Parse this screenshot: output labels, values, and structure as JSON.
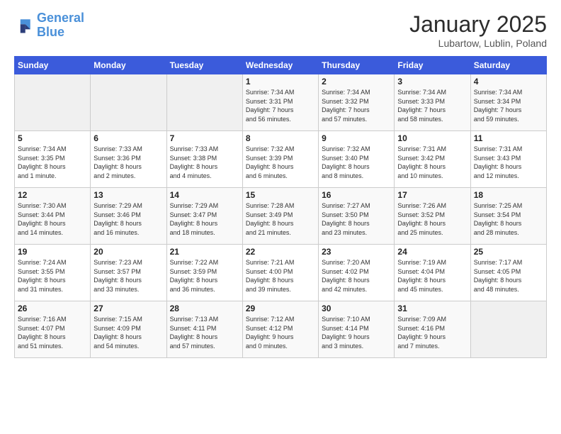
{
  "header": {
    "logo_line1": "General",
    "logo_line2": "Blue",
    "title": "January 2025",
    "subtitle": "Lubartow, Lublin, Poland"
  },
  "days_of_week": [
    "Sunday",
    "Monday",
    "Tuesday",
    "Wednesday",
    "Thursday",
    "Friday",
    "Saturday"
  ],
  "weeks": [
    [
      {
        "day": "",
        "info": ""
      },
      {
        "day": "",
        "info": ""
      },
      {
        "day": "",
        "info": ""
      },
      {
        "day": "1",
        "info": "Sunrise: 7:34 AM\nSunset: 3:31 PM\nDaylight: 7 hours\nand 56 minutes."
      },
      {
        "day": "2",
        "info": "Sunrise: 7:34 AM\nSunset: 3:32 PM\nDaylight: 7 hours\nand 57 minutes."
      },
      {
        "day": "3",
        "info": "Sunrise: 7:34 AM\nSunset: 3:33 PM\nDaylight: 7 hours\nand 58 minutes."
      },
      {
        "day": "4",
        "info": "Sunrise: 7:34 AM\nSunset: 3:34 PM\nDaylight: 7 hours\nand 59 minutes."
      }
    ],
    [
      {
        "day": "5",
        "info": "Sunrise: 7:34 AM\nSunset: 3:35 PM\nDaylight: 8 hours\nand 1 minute."
      },
      {
        "day": "6",
        "info": "Sunrise: 7:33 AM\nSunset: 3:36 PM\nDaylight: 8 hours\nand 2 minutes."
      },
      {
        "day": "7",
        "info": "Sunrise: 7:33 AM\nSunset: 3:38 PM\nDaylight: 8 hours\nand 4 minutes."
      },
      {
        "day": "8",
        "info": "Sunrise: 7:32 AM\nSunset: 3:39 PM\nDaylight: 8 hours\nand 6 minutes."
      },
      {
        "day": "9",
        "info": "Sunrise: 7:32 AM\nSunset: 3:40 PM\nDaylight: 8 hours\nand 8 minutes."
      },
      {
        "day": "10",
        "info": "Sunrise: 7:31 AM\nSunset: 3:42 PM\nDaylight: 8 hours\nand 10 minutes."
      },
      {
        "day": "11",
        "info": "Sunrise: 7:31 AM\nSunset: 3:43 PM\nDaylight: 8 hours\nand 12 minutes."
      }
    ],
    [
      {
        "day": "12",
        "info": "Sunrise: 7:30 AM\nSunset: 3:44 PM\nDaylight: 8 hours\nand 14 minutes."
      },
      {
        "day": "13",
        "info": "Sunrise: 7:29 AM\nSunset: 3:46 PM\nDaylight: 8 hours\nand 16 minutes."
      },
      {
        "day": "14",
        "info": "Sunrise: 7:29 AM\nSunset: 3:47 PM\nDaylight: 8 hours\nand 18 minutes."
      },
      {
        "day": "15",
        "info": "Sunrise: 7:28 AM\nSunset: 3:49 PM\nDaylight: 8 hours\nand 21 minutes."
      },
      {
        "day": "16",
        "info": "Sunrise: 7:27 AM\nSunset: 3:50 PM\nDaylight: 8 hours\nand 23 minutes."
      },
      {
        "day": "17",
        "info": "Sunrise: 7:26 AM\nSunset: 3:52 PM\nDaylight: 8 hours\nand 25 minutes."
      },
      {
        "day": "18",
        "info": "Sunrise: 7:25 AM\nSunset: 3:54 PM\nDaylight: 8 hours\nand 28 minutes."
      }
    ],
    [
      {
        "day": "19",
        "info": "Sunrise: 7:24 AM\nSunset: 3:55 PM\nDaylight: 8 hours\nand 31 minutes."
      },
      {
        "day": "20",
        "info": "Sunrise: 7:23 AM\nSunset: 3:57 PM\nDaylight: 8 hours\nand 33 minutes."
      },
      {
        "day": "21",
        "info": "Sunrise: 7:22 AM\nSunset: 3:59 PM\nDaylight: 8 hours\nand 36 minutes."
      },
      {
        "day": "22",
        "info": "Sunrise: 7:21 AM\nSunset: 4:00 PM\nDaylight: 8 hours\nand 39 minutes."
      },
      {
        "day": "23",
        "info": "Sunrise: 7:20 AM\nSunset: 4:02 PM\nDaylight: 8 hours\nand 42 minutes."
      },
      {
        "day": "24",
        "info": "Sunrise: 7:19 AM\nSunset: 4:04 PM\nDaylight: 8 hours\nand 45 minutes."
      },
      {
        "day": "25",
        "info": "Sunrise: 7:17 AM\nSunset: 4:05 PM\nDaylight: 8 hours\nand 48 minutes."
      }
    ],
    [
      {
        "day": "26",
        "info": "Sunrise: 7:16 AM\nSunset: 4:07 PM\nDaylight: 8 hours\nand 51 minutes."
      },
      {
        "day": "27",
        "info": "Sunrise: 7:15 AM\nSunset: 4:09 PM\nDaylight: 8 hours\nand 54 minutes."
      },
      {
        "day": "28",
        "info": "Sunrise: 7:13 AM\nSunset: 4:11 PM\nDaylight: 8 hours\nand 57 minutes."
      },
      {
        "day": "29",
        "info": "Sunrise: 7:12 AM\nSunset: 4:12 PM\nDaylight: 9 hours\nand 0 minutes."
      },
      {
        "day": "30",
        "info": "Sunrise: 7:10 AM\nSunset: 4:14 PM\nDaylight: 9 hours\nand 3 minutes."
      },
      {
        "day": "31",
        "info": "Sunrise: 7:09 AM\nSunset: 4:16 PM\nDaylight: 9 hours\nand 7 minutes."
      },
      {
        "day": "",
        "info": ""
      }
    ]
  ]
}
